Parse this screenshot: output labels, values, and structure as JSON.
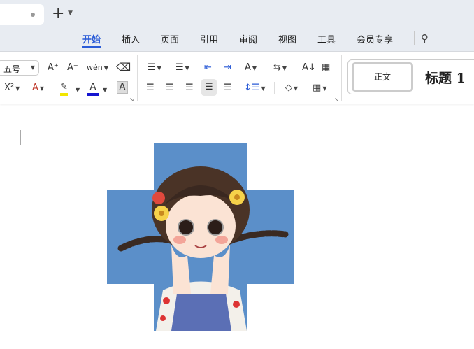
{
  "tabbar": {
    "new_tab": "+",
    "chevron": "⌄"
  },
  "menu": [
    {
      "label": "开始",
      "active": true
    },
    {
      "label": "插入"
    },
    {
      "label": "页面"
    },
    {
      "label": "引用"
    },
    {
      "label": "审阅"
    },
    {
      "label": "视图"
    },
    {
      "label": "工具"
    },
    {
      "label": "会员专享"
    }
  ],
  "toolbar": {
    "font_size": "五号",
    "grow": "A⁺",
    "shrink": "A⁻",
    "pinyin": "wén",
    "clear": "⌫",
    "superscript": "X²",
    "text_effect": "A",
    "highlight": "✎",
    "font_color": "A",
    "char_shade": "A",
    "bullets": "☰",
    "numbering": "☰",
    "outdent": "⇤",
    "indent": "⇥",
    "char_spacing": "A",
    "text_dir": "⇆",
    "sort": "A↓",
    "table": "▦",
    "align_left": "☰",
    "align_center": "☰",
    "align_right": "☰",
    "justify": "☰",
    "distributed": "☰",
    "line_spacing": "↕☰",
    "fill": "◇",
    "border": "▦"
  },
  "styles": {
    "normal": "正文",
    "heading1": "标题 1"
  },
  "colors": {
    "accent": "#2a5bd7",
    "highlight": "#f2e600",
    "font_color": "#1515d0",
    "image_bg": "#5b8fc9"
  }
}
